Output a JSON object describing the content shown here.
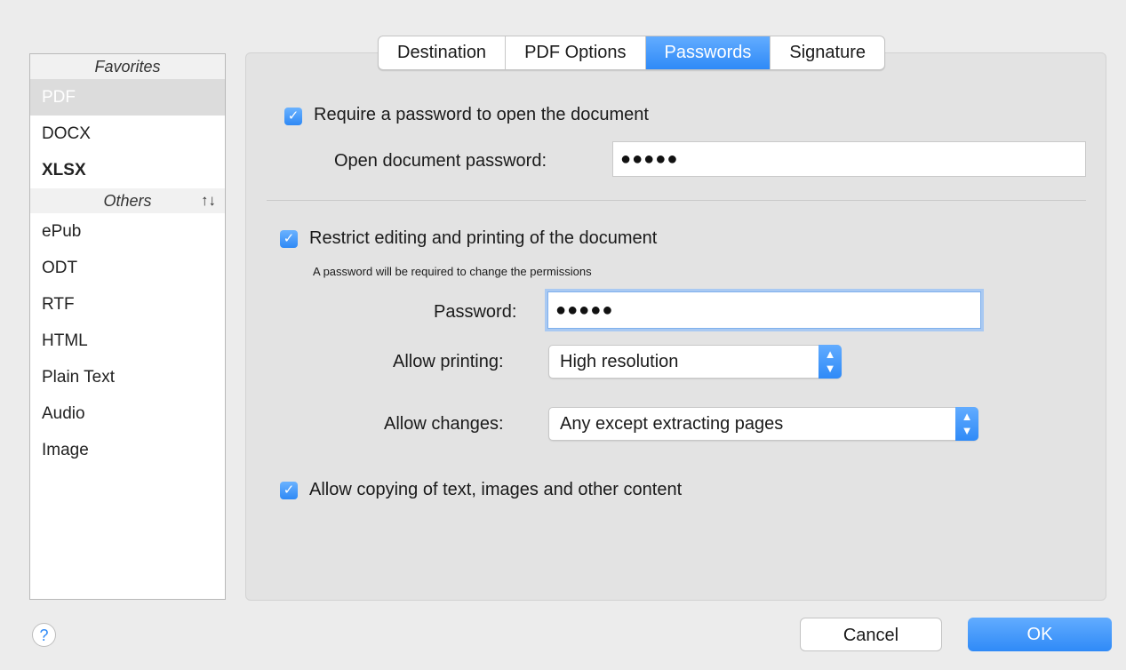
{
  "sidebar": {
    "favorites_header": "Favorites",
    "favorites": [
      "PDF",
      "DOCX",
      "XLSX"
    ],
    "others_header": "Others",
    "others_sort_icon": "↑↓",
    "others": [
      "ePub",
      "ODT",
      "RTF",
      "HTML",
      "Plain Text",
      "Audio",
      "Image"
    ]
  },
  "tabs": [
    "Destination",
    "PDF Options",
    "Passwords",
    "Signature"
  ],
  "passwords": {
    "require_open_label": "Require a password to open the document",
    "open_password_label": "Open document password:",
    "open_password_value": "●●●●●",
    "restrict_label": "Restrict editing and printing of the document",
    "restrict_note": "A password will be required to change the permissions",
    "password_label": "Password:",
    "password_value": "●●●●●",
    "allow_printing_label": "Allow printing:",
    "allow_printing_value": "High resolution",
    "allow_changes_label": "Allow changes:",
    "allow_changes_value": "Any except extracting pages",
    "allow_copying_label": "Allow copying of text, images and other content"
  },
  "footer": {
    "help": "?",
    "cancel": "Cancel",
    "ok": "OK"
  },
  "colors": {
    "accent": "#2f8af7"
  }
}
